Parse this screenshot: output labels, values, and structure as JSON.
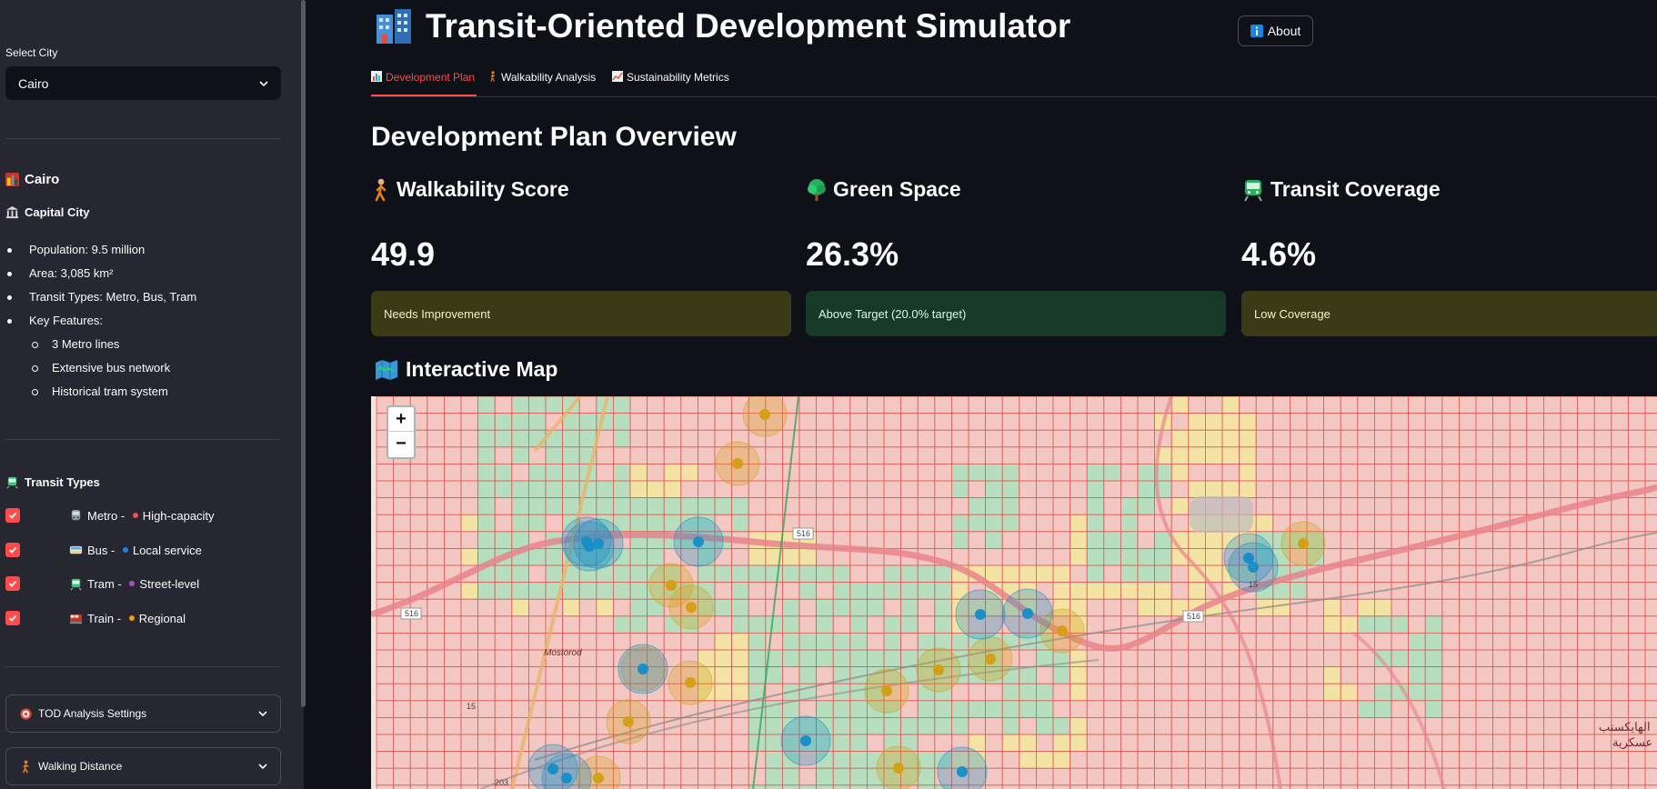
{
  "sidebar": {
    "select_label": "Select City",
    "selected_city": "Cairo",
    "city_title": "Cairo",
    "city_subtitle": "Capital City",
    "facts": [
      "Population: 9.5 million",
      "Area: 3,085 km²",
      "Transit Types: Metro, Bus, Tram",
      "Key Features:"
    ],
    "key_features": [
      "3 Metro lines",
      "Extensive bus network",
      "Historical tram system"
    ],
    "transit_types_title": "Transit Types",
    "transit_types": [
      {
        "name": "Metro",
        "desc": "High-capacity",
        "color": "#ff4b4b",
        "checked": true
      },
      {
        "name": "Bus",
        "desc": "Local service",
        "color": "#1c83e1",
        "checked": true
      },
      {
        "name": "Tram",
        "desc": "Street-level",
        "color": "#9b59b6",
        "checked": true
      },
      {
        "name": "Train",
        "desc": "Regional",
        "color": "#f39c12",
        "checked": true
      }
    ],
    "separator": " - ",
    "expanders": [
      "TOD Analysis Settings",
      "Walking Distance"
    ]
  },
  "header": {
    "title": "Transit-Oriented Development Simulator",
    "about": "About"
  },
  "tabs": [
    "Development Plan",
    "Walkability Analysis",
    "Sustainability Metrics"
  ],
  "section_title": "Development Plan Overview",
  "metrics": [
    {
      "title": "Walkability Score",
      "value": "49.9",
      "status": "Needs Improvement",
      "level": "warning"
    },
    {
      "title": "Green Space",
      "value": "26.3%",
      "status": "Above Target (20.0% target)",
      "level": "success"
    },
    {
      "title": "Transit Coverage",
      "value": "4.6%",
      "status": "Low Coverage",
      "level": "warning"
    }
  ],
  "map": {
    "title": "Interactive Map",
    "zoom_in": "+",
    "zoom_out": "−",
    "road_labels": [
      "516",
      "516",
      "516",
      "15",
      "15",
      "203"
    ],
    "place_labels": [
      "Mostorod",
      "الهايكستب",
      "عسكرية"
    ],
    "colors": {
      "red_cell": "#f5a3a0",
      "yellow_cell": "#f4e27d",
      "green_cell": "#9ddcb1",
      "bus_station": "#1b8fc7",
      "train_station": "#d4a017",
      "grid_line": "#e05a57"
    }
  }
}
